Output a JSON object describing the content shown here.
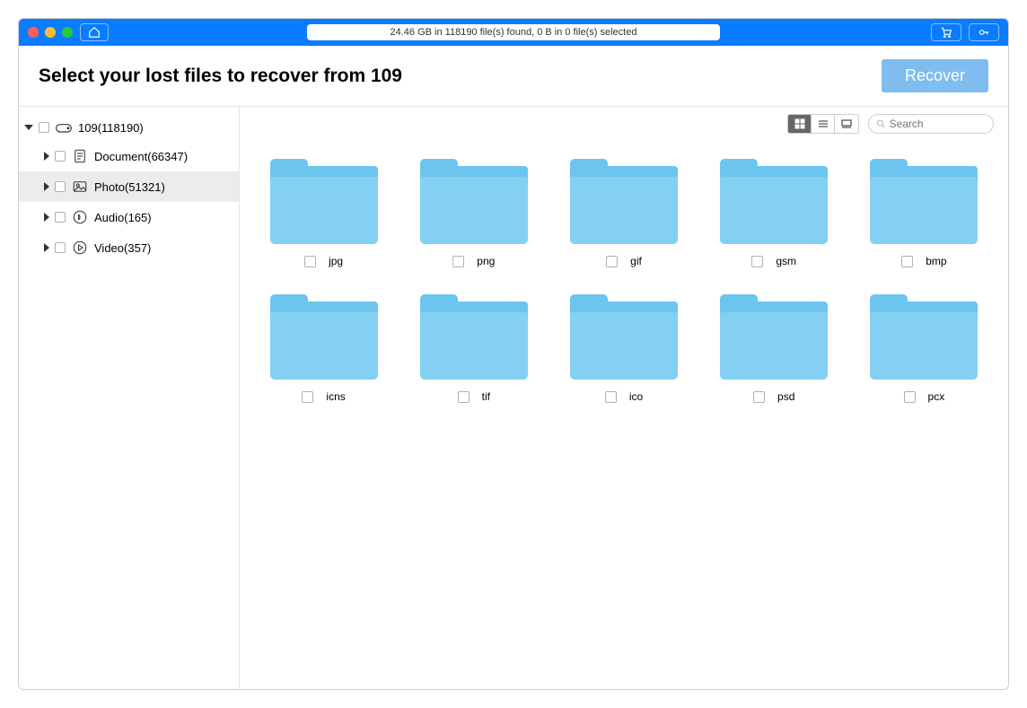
{
  "status_text": "24.46 GB in 118190 file(s) found, 0 B in 0 file(s) selected",
  "page_title": "Select your lost files to recover from 109",
  "recover_label": "Recover",
  "search_placeholder": "Search",
  "sidebar": {
    "root": {
      "label": "109(118190)"
    },
    "children": [
      {
        "label": "Document(66347)",
        "icon": "document"
      },
      {
        "label": "Photo(51321)",
        "icon": "photo",
        "selected": true
      },
      {
        "label": "Audio(165)",
        "icon": "audio"
      },
      {
        "label": "Video(357)",
        "icon": "video"
      }
    ]
  },
  "folders": [
    {
      "label": "jpg"
    },
    {
      "label": "png"
    },
    {
      "label": "gif"
    },
    {
      "label": "gsm"
    },
    {
      "label": "bmp"
    },
    {
      "label": "icns"
    },
    {
      "label": "tif"
    },
    {
      "label": "ico"
    },
    {
      "label": "psd"
    },
    {
      "label": "pcx"
    }
  ]
}
